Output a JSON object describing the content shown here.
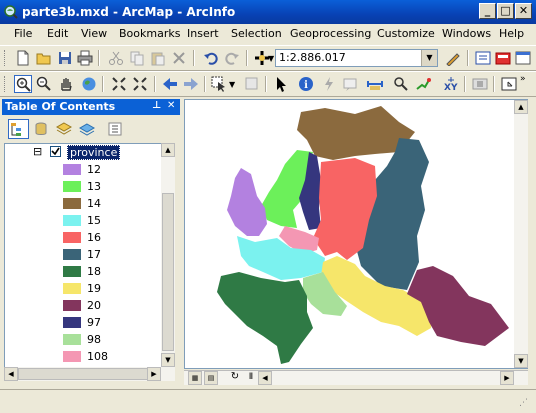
{
  "window": {
    "title": "parte3b.mxd - ArcMap - ArcInfo",
    "minimize_glyph": "_",
    "maximize_glyph": "□",
    "close_glyph": "✕"
  },
  "menu": [
    "File",
    "Edit",
    "View",
    "Bookmarks",
    "Insert",
    "Selection",
    "Geoprocessing",
    "Customize",
    "Windows",
    "Help"
  ],
  "scale": {
    "value": "1:2.886.017"
  },
  "toc": {
    "title": "Table Of Contents",
    "pin_glyph": "📌",
    "close_glyph": "✕",
    "layer_name": "province",
    "layer_checked": true,
    "expand_glyph": "⊟",
    "legend": [
      {
        "label": "12",
        "color": "#b381e0"
      },
      {
        "label": "13",
        "color": "#6cf05a"
      },
      {
        "label": "14",
        "color": "#8b6a3e"
      },
      {
        "label": "15",
        "color": "#7bf2ef"
      },
      {
        "label": "16",
        "color": "#f86464"
      },
      {
        "label": "17",
        "color": "#3a6478"
      },
      {
        "label": "18",
        "color": "#2f7a45"
      },
      {
        "label": "19",
        "color": "#f6e66a"
      },
      {
        "label": "20",
        "color": "#83355d"
      },
      {
        "label": "97",
        "color": "#35367e"
      },
      {
        "label": "98",
        "color": "#a8e09a"
      },
      {
        "label": "108",
        "color": "#f497b3"
      }
    ]
  },
  "icons": {
    "toolbar1": [
      "new-document-icon",
      "open-folder-icon",
      "save-icon",
      "print-icon",
      "cut-icon",
      "copy-icon",
      "paste-icon",
      "delete-icon",
      "undo-icon",
      "redo-icon",
      "add-data-icon",
      "editor-toolbar-icon",
      "arctoolbox-icon",
      "catalog-icon",
      "search-window-icon"
    ],
    "toolbar2": [
      "zoom-in-icon",
      "zoom-out-icon",
      "pan-icon",
      "full-extent-icon",
      "fixed-zoom-in-icon",
      "fixed-zoom-out-icon",
      "back-extent-icon",
      "forward-extent-icon",
      "select-features-icon",
      "clear-selection-icon",
      "select-elements-icon",
      "identify-icon",
      "hyperlink-icon",
      "html-popup-icon",
      "measure-icon",
      "find-route-icon",
      "xy-icon",
      "time-slider-icon",
      "viewer-icon"
    ]
  }
}
